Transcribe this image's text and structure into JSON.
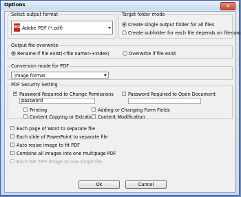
{
  "window": {
    "title": "Options",
    "close_icon": "close-icon"
  },
  "output_format": {
    "group_label": "Select output format",
    "selected": "Adobe PDF (*.pdf)",
    "icon": "pdf-icon",
    "icon_text": "PDF"
  },
  "target_folder": {
    "group_label": "Target folder mode",
    "options": [
      "Create single output folder for all files",
      "Create subfolder for each file depends on filename"
    ],
    "selected_index": 0
  },
  "overwrite": {
    "group_label": "Output file overwrite",
    "options": [
      "Rename if file exist(<file name>+index)",
      "Overwrite if file exist"
    ],
    "selected_index": 0
  },
  "conversion": {
    "group_label": "Conversion mode for PDF",
    "selected": "Image format"
  },
  "security": {
    "group_label": "PDF Security Setting",
    "change_perm_label": "Password Required to Change Pemissions",
    "change_perm_checked": true,
    "change_perm_password": "password",
    "open_doc_label": "Password Required to Open Document",
    "open_doc_checked": false,
    "open_doc_password": "",
    "permissions": [
      {
        "label": "Printing",
        "checked": false
      },
      {
        "label": "Adding or Changing Form Fields",
        "checked": false
      },
      {
        "label": "Content Copying or Extration",
        "checked": false
      },
      {
        "label": "Content Modification",
        "checked": false
      }
    ]
  },
  "options": [
    {
      "label": "Each page of Word to separate file",
      "checked": false,
      "enabled": true
    },
    {
      "label": "Each slide of PowerPoint to separate file",
      "checked": false,
      "enabled": true
    },
    {
      "label": "Auto resize image to fit PDF",
      "checked": false,
      "enabled": true
    },
    {
      "label": "Combine all images into one multipage PDF",
      "checked": false,
      "enabled": true
    },
    {
      "label": "Each GIF TIFF image to one single file",
      "checked": false,
      "enabled": false
    }
  ],
  "buttons": {
    "ok": "Ok",
    "cancel": "Cancel"
  }
}
